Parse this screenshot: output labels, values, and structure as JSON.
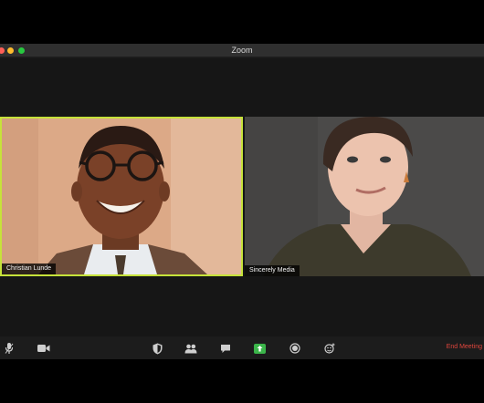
{
  "window": {
    "title": "Zoom"
  },
  "participants": [
    {
      "name": "Christian Lunde",
      "active_speaker": true
    },
    {
      "name": "Sincerely Media",
      "active_speaker": false
    }
  ],
  "toolbar": {
    "items": [
      {
        "icon": "microphone-icon"
      },
      {
        "icon": "video-camera-icon"
      },
      {
        "icon": "security-shield-icon"
      },
      {
        "icon": "participants-icon"
      },
      {
        "icon": "chat-bubble-icon"
      },
      {
        "icon": "share-screen-icon"
      },
      {
        "icon": "record-icon"
      },
      {
        "icon": "reactions-icon"
      }
    ],
    "end_label": "End Meeting"
  },
  "colors": {
    "active_speaker_border": "#c6e23a",
    "end_meeting_red": "#e0463d",
    "share_green": "#3bb54a"
  }
}
